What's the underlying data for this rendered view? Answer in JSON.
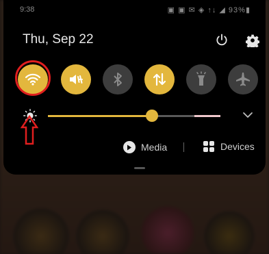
{
  "status_bar": {
    "time": "9:38",
    "icons": "▣ ▣ ✉ ◈ ↑↓ ◢ 93%▮"
  },
  "header": {
    "date": "Thu, Sep 22"
  },
  "tiles": [
    {
      "name": "wifi",
      "state": "on"
    },
    {
      "name": "sound-mute",
      "state": "on"
    },
    {
      "name": "bluetooth",
      "state": "off"
    },
    {
      "name": "mobile-data",
      "state": "on"
    },
    {
      "name": "flashlight",
      "state": "off"
    },
    {
      "name": "airplane-mode",
      "state": "off"
    }
  ],
  "brightness": {
    "level": 0.6
  },
  "media": {
    "label": "Media"
  },
  "devices": {
    "label": "Devices"
  },
  "colors": {
    "accent": "#e3b73d",
    "tile_off": "#3d3d3d",
    "annotation": "#e01e1e"
  }
}
